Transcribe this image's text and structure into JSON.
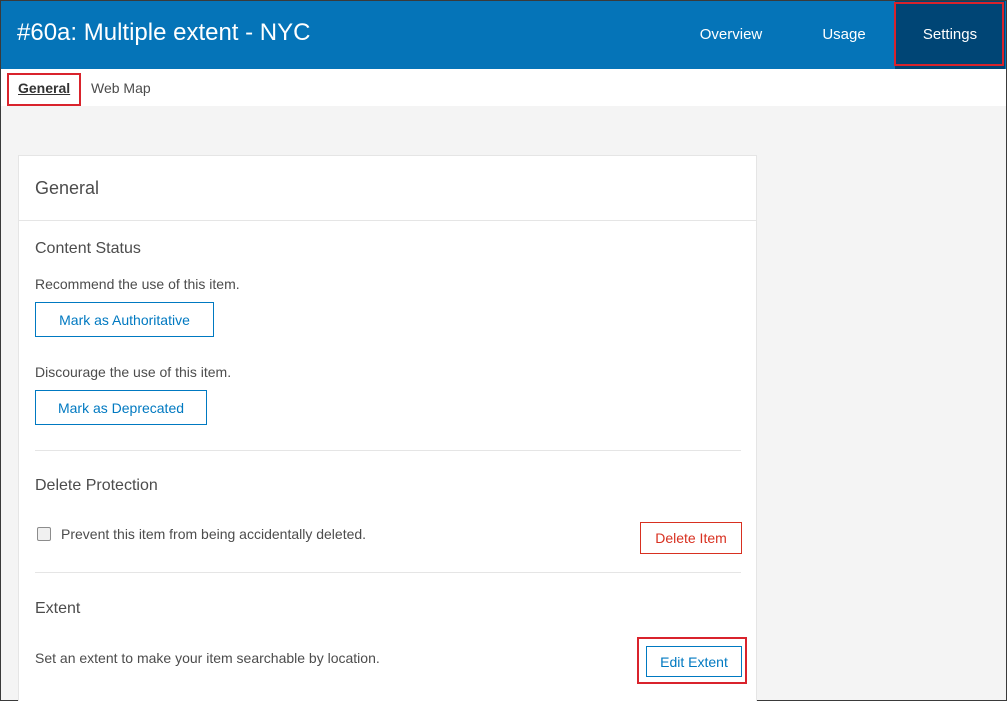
{
  "header": {
    "title": "#60a: Multiple extent - NYC",
    "nav": {
      "overview": "Overview",
      "usage": "Usage",
      "settings": "Settings"
    }
  },
  "subnav": {
    "general": "General",
    "webmap": "Web Map"
  },
  "card": {
    "title": "General",
    "content_status": {
      "title": "Content Status",
      "recommend_text": "Recommend the use of this item.",
      "authoritative_button": "Mark as Authoritative",
      "discourage_text": "Discourage the use of this item.",
      "deprecated_button": "Mark as Deprecated"
    },
    "delete_protection": {
      "title": "Delete Protection",
      "checkbox_label": "Prevent this item from being accidentally deleted.",
      "checked": false,
      "delete_button": "Delete Item"
    },
    "extent": {
      "title": "Extent",
      "text": "Set an extent to make your item searchable by location.",
      "edit_button": "Edit Extent"
    }
  },
  "colors": {
    "header_bg": "#0574b8",
    "active_tab_bg": "#004575",
    "accent": "#0079c1",
    "danger": "#d83020",
    "highlight": "#d9232c"
  }
}
